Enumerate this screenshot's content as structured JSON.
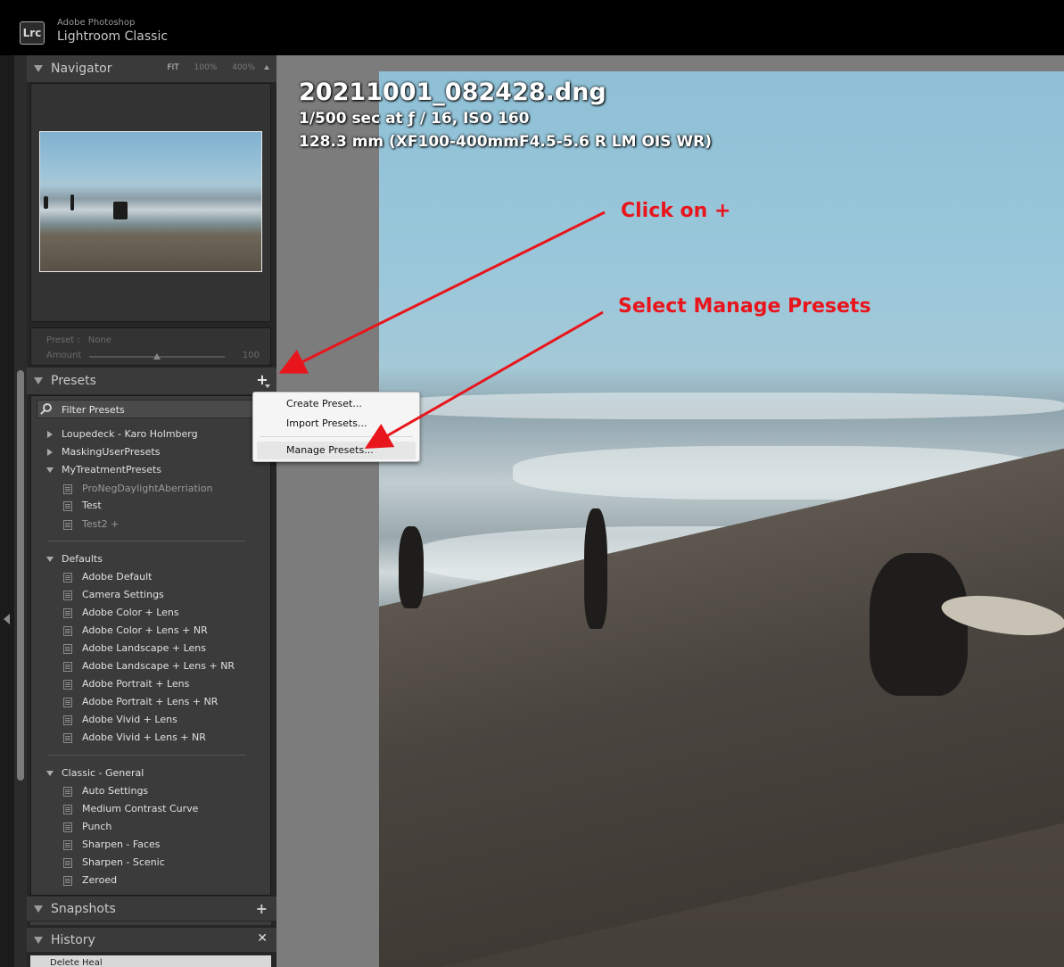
{
  "app": {
    "logo_text": "Lrc",
    "subtitle": "Adobe Photoshop",
    "name": "Lightroom Classic"
  },
  "navigator": {
    "title": "Navigator",
    "zoom": [
      "FIT",
      "100%",
      "400%"
    ]
  },
  "preset_amount": {
    "preset_label": "Preset :",
    "preset_value": "None",
    "amount_label": "Amount",
    "amount_value": "100",
    "amount_level": 0.5
  },
  "presets": {
    "title": "Presets",
    "filter_placeholder": "Filter Presets",
    "groups": [
      {
        "name": "Loupedeck - Karo Holmberg",
        "expanded": false
      },
      {
        "name": "MaskingUserPresets",
        "expanded": false
      },
      {
        "name": "MyTreatmentPresets",
        "expanded": true,
        "items": [
          "ProNegDaylightAberriation",
          "Test",
          "Test2  +"
        ]
      },
      {
        "name": "Defaults",
        "expanded": true,
        "items": [
          "Adobe Default",
          "Camera Settings",
          "Adobe Color + Lens",
          "Adobe Color + Lens + NR",
          "Adobe Landscape + Lens",
          "Adobe Landscape + Lens + NR",
          "Adobe Portrait + Lens",
          "Adobe Portrait + Lens + NR",
          "Adobe Vivid + Lens",
          "Adobe Vivid + Lens + NR"
        ]
      },
      {
        "name": "Classic - General",
        "expanded": true,
        "items": [
          "Auto Settings",
          "Medium Contrast Curve",
          "Punch",
          "Sharpen - Faces",
          "Sharpen - Scenic",
          "Zeroed"
        ]
      }
    ]
  },
  "snapshots": {
    "title": "Snapshots"
  },
  "history": {
    "title": "History",
    "items": [
      "Delete Heal"
    ]
  },
  "photo_info": {
    "filename": "20211001_082428.dng",
    "exposure": "1/500 sec at ƒ / 16, ISO 160",
    "lens": "128.3 mm (XF100-400mmF4.5-5.6 R LM OIS WR)"
  },
  "context_menu": {
    "items": [
      "Create Preset...",
      "Import Presets...",
      "Manage Presets..."
    ]
  },
  "annotations": {
    "step1": "Click on +",
    "step2": "Select Manage Presets",
    "color": "#e8161c"
  }
}
